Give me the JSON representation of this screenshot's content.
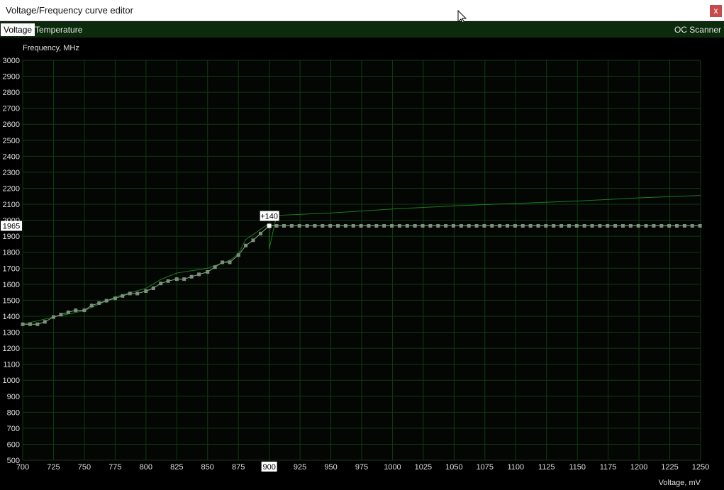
{
  "window": {
    "title": "Voltage/Frequency curve editor",
    "close_label": "x"
  },
  "tabs": [
    {
      "label": "Voltage"
    },
    {
      "label": "Temperature"
    }
  ],
  "oc_scanner_label": "OC Scanner",
  "colors": {
    "background": "#000000",
    "grid": "#123a12",
    "curve": "#8aaa8a",
    "point": "#7d8f7d",
    "default_curve": "#1f7a1f",
    "tab_bar": "#0c2a0c",
    "close": "#c84a4a"
  },
  "chart_data": {
    "type": "line",
    "ylabel": "Frequency, MHz",
    "xlabel": "Voltage, mV",
    "xlim": [
      700,
      1250
    ],
    "ylim": [
      500,
      3000
    ],
    "x_ticks": [
      700,
      725,
      750,
      775,
      800,
      825,
      850,
      875,
      900,
      925,
      950,
      975,
      1000,
      1025,
      1050,
      1075,
      1100,
      1125,
      1150,
      1175,
      1200,
      1225,
      1250
    ],
    "y_ticks": [
      500,
      600,
      700,
      800,
      900,
      1000,
      1100,
      1200,
      1300,
      1400,
      1500,
      1600,
      1700,
      1800,
      1900,
      2000,
      2100,
      2200,
      2300,
      2400,
      2500,
      2600,
      2700,
      2800,
      2900,
      3000
    ],
    "grid": true,
    "selected_point": {
      "x": 900,
      "y": 1965,
      "offset_label": "+140",
      "x_label": "900",
      "y_label": "1965"
    },
    "series": [
      {
        "role": "edited",
        "points": [
          [
            700,
            1350
          ],
          [
            706,
            1350
          ],
          [
            712,
            1350
          ],
          [
            718,
            1365
          ],
          [
            725,
            1395
          ],
          [
            731,
            1410
          ],
          [
            737,
            1425
          ],
          [
            743,
            1437
          ],
          [
            750,
            1437
          ],
          [
            756,
            1467
          ],
          [
            762,
            1482
          ],
          [
            768,
            1497
          ],
          [
            775,
            1512
          ],
          [
            781,
            1527
          ],
          [
            787,
            1542
          ],
          [
            793,
            1542
          ],
          [
            800,
            1557
          ],
          [
            806,
            1575
          ],
          [
            812,
            1605
          ],
          [
            818,
            1620
          ],
          [
            825,
            1632
          ],
          [
            831,
            1632
          ],
          [
            837,
            1647
          ],
          [
            843,
            1662
          ],
          [
            850,
            1677
          ],
          [
            856,
            1707
          ],
          [
            862,
            1737
          ],
          [
            868,
            1737
          ],
          [
            875,
            1782
          ],
          [
            881,
            1842
          ],
          [
            887,
            1875
          ],
          [
            893,
            1917
          ],
          [
            900,
            1965
          ],
          [
            906,
            1965
          ],
          [
            1250,
            1965
          ]
        ]
      },
      {
        "role": "default",
        "points": [
          [
            700,
            1350
          ],
          [
            725,
            1395
          ],
          [
            750,
            1435
          ],
          [
            775,
            1520
          ],
          [
            800,
            1575
          ],
          [
            812,
            1630
          ],
          [
            825,
            1670
          ],
          [
            850,
            1700
          ],
          [
            868,
            1750
          ],
          [
            875,
            1790
          ],
          [
            881,
            1880
          ],
          [
            900,
            1980
          ],
          [
            900,
            1820
          ],
          [
            906,
            2030
          ],
          [
            950,
            2045
          ],
          [
            1000,
            2070
          ],
          [
            1050,
            2090
          ],
          [
            1100,
            2105
          ],
          [
            1150,
            2120
          ],
          [
            1200,
            2140
          ],
          [
            1250,
            2155
          ]
        ]
      }
    ]
  }
}
